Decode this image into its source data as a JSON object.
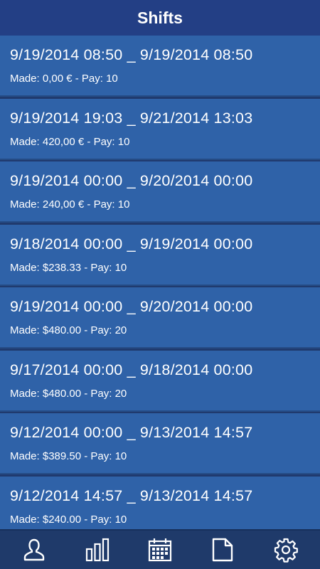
{
  "header": {
    "title": "Shifts"
  },
  "shifts": [
    {
      "range": "9/19/2014 08:50 _ 9/19/2014 08:50",
      "made": "Made: 0,00 € - Pay: 10"
    },
    {
      "range": "9/19/2014 19:03 _ 9/21/2014 13:03",
      "made": "Made: 420,00 € - Pay: 10"
    },
    {
      "range": "9/19/2014 00:00 _ 9/20/2014 00:00",
      "made": "Made: 240,00 € - Pay: 10"
    },
    {
      "range": "9/18/2014 00:00 _ 9/19/2014 00:00",
      "made": "Made: $238.33 - Pay: 10"
    },
    {
      "range": "9/19/2014 00:00 _ 9/20/2014 00:00",
      "made": "Made: $480.00 - Pay: 20"
    },
    {
      "range": "9/17/2014 00:00 _ 9/18/2014 00:00",
      "made": "Made: $480.00 - Pay: 20"
    },
    {
      "range": "9/12/2014 00:00 _ 9/13/2014 14:57",
      "made": "Made: $389.50 - Pay: 10"
    },
    {
      "range": "9/12/2014 14:57 _ 9/13/2014 14:57",
      "made": "Made: $240.00 - Pay: 10"
    }
  ],
  "nav": {
    "items": [
      {
        "icon": "person-icon"
      },
      {
        "icon": "bar-chart-icon"
      },
      {
        "icon": "calendar-icon"
      },
      {
        "icon": "document-icon"
      },
      {
        "icon": "gear-icon"
      }
    ]
  },
  "colors": {
    "header_bg": "#233f85",
    "item_bg": "#2f62a8",
    "nav_bg": "#1f3a6a",
    "text": "#ffffff"
  }
}
